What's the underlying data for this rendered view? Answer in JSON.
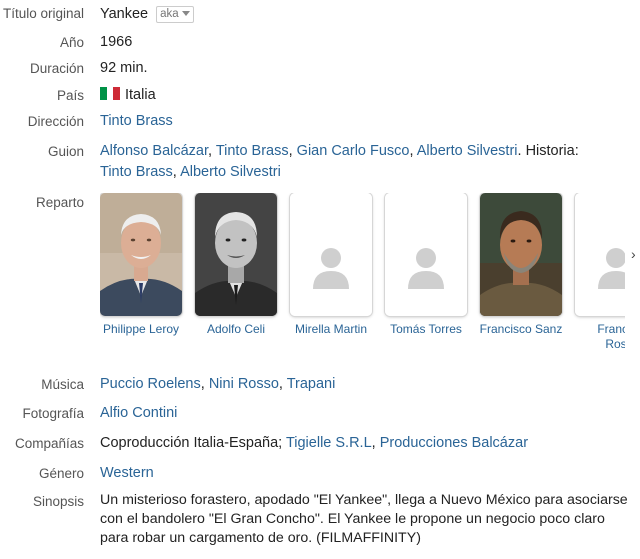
{
  "labels": {
    "original_title": "Título original",
    "year": "Año",
    "duration": "Duración",
    "country": "País",
    "direction": "Dirección",
    "script": "Guion",
    "cast": "Reparto",
    "music": "Música",
    "photography": "Fotografía",
    "companies": "Compañías",
    "genre": "Género",
    "synopsis": "Sinopsis"
  },
  "movie": {
    "original_title": "Yankee",
    "aka_label": "aka",
    "year": "1966",
    "duration": "92 min.",
    "country": "Italia",
    "flag_colors": [
      "#009246",
      "#ffffff",
      "#ce2b37"
    ],
    "director": "Tinto Brass",
    "script": [
      "Alfonso Balcázar",
      "Tinto Brass",
      "Gian Carlo Fusco",
      "Alberto Silvestri"
    ],
    "story_label": "Historia:",
    "story": [
      "Tinto Brass",
      "Alberto Silvestri"
    ],
    "cast": [
      {
        "name": "Philippe Leroy"
      },
      {
        "name": "Adolfo Celi"
      },
      {
        "name": "Mirella Martin"
      },
      {
        "name": "Tomás Torres"
      },
      {
        "name": "Francisco Sanz"
      },
      {
        "name": "Franco Ros"
      }
    ],
    "music": [
      "Puccio Roelens",
      "Nini Rosso",
      "Trapani"
    ],
    "photography": "Alfio Contini",
    "companies_text": "Coproducción Italia-España;",
    "companies": [
      "Tigielle S.R.L",
      "Producciones Balcázar"
    ],
    "genre": "Western",
    "synopsis": "Un misterioso forastero, apodado \"El Yankee\", llega a Nuevo México para asociarse con el bandolero \"El Gran Concho\". El Yankee le propone un negocio poco claro para robar un cargamento de oro. (FILMAFFINITY)"
  },
  "colors": {
    "link": "#2a6496",
    "label": "#555555"
  }
}
